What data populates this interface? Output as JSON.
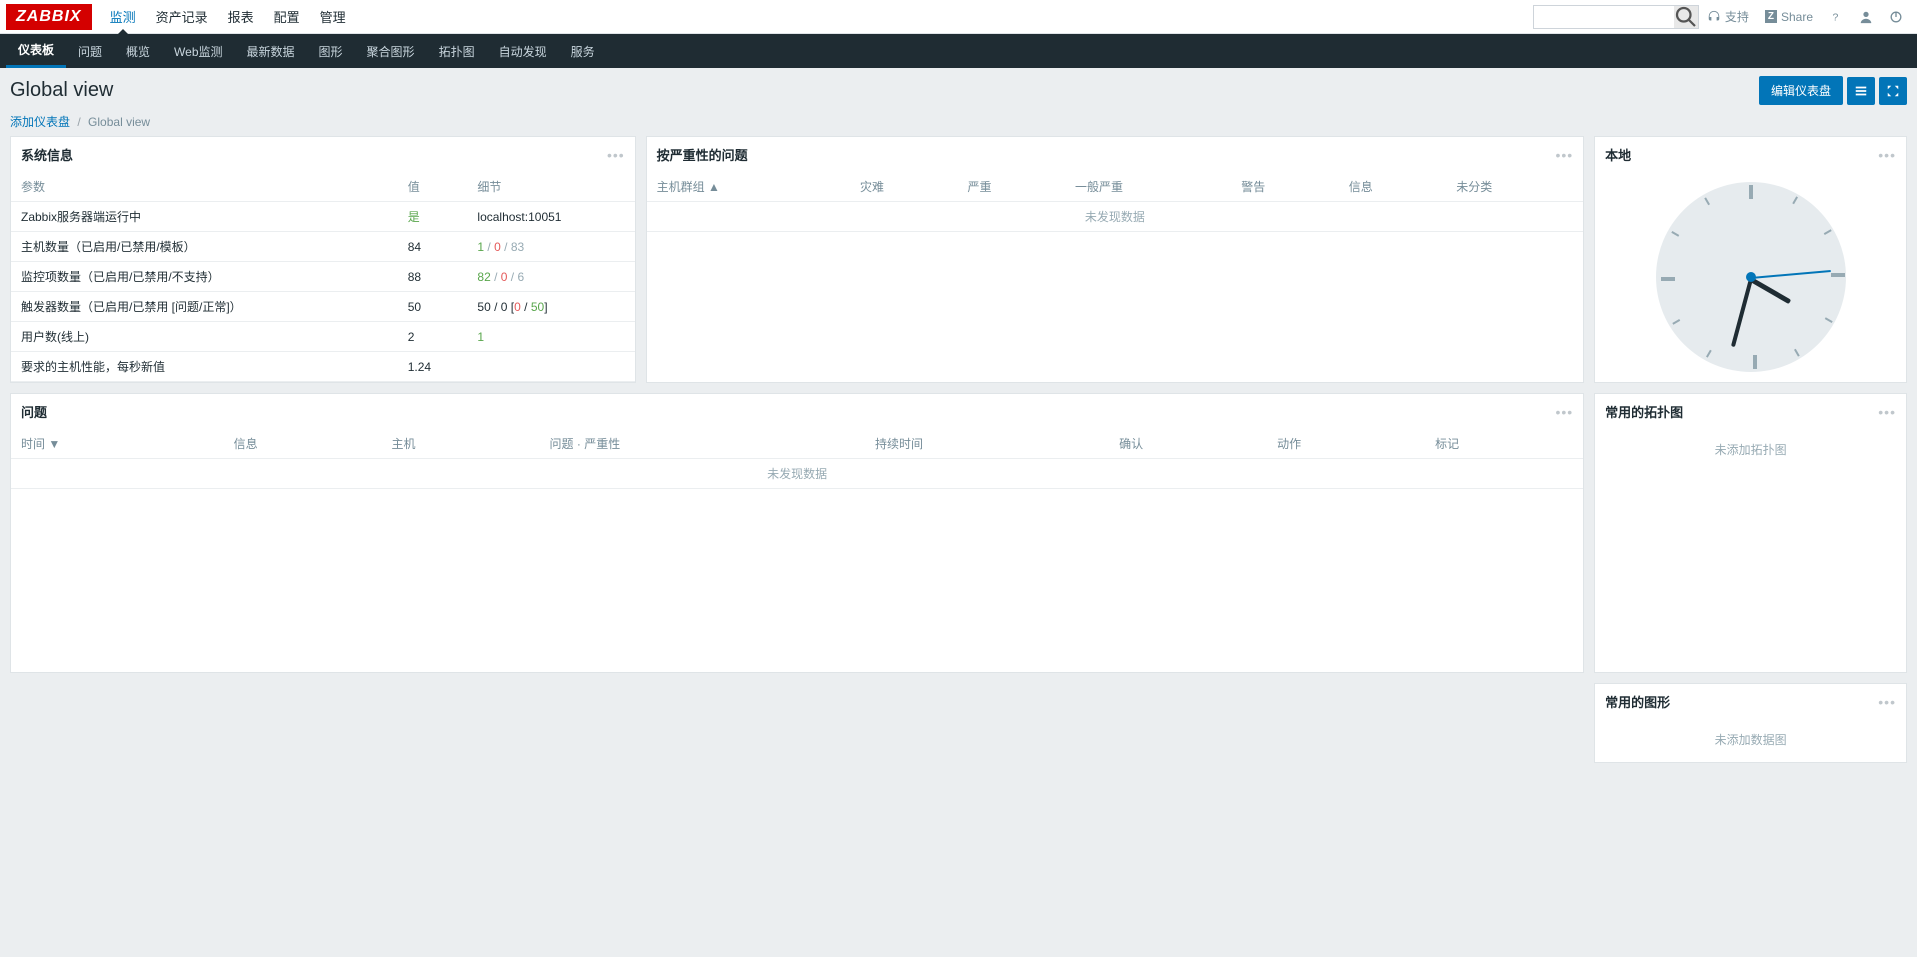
{
  "branding": {
    "logo": "ZABBIX"
  },
  "topnav": {
    "items": [
      {
        "label": "监测",
        "active": true
      },
      {
        "label": "资产记录"
      },
      {
        "label": "报表"
      },
      {
        "label": "配置"
      },
      {
        "label": "管理"
      }
    ],
    "support": "支持",
    "share": "Share"
  },
  "subnav": {
    "items": [
      {
        "label": "仪表板",
        "active": true
      },
      {
        "label": "问题"
      },
      {
        "label": "概览"
      },
      {
        "label": "Web监测"
      },
      {
        "label": "最新数据"
      },
      {
        "label": "图形"
      },
      {
        "label": "聚合图形"
      },
      {
        "label": "拓扑图"
      },
      {
        "label": "自动发现"
      },
      {
        "label": "服务"
      }
    ]
  },
  "page": {
    "title": "Global view",
    "edit_btn": "编辑仪表盘"
  },
  "breadcrumb": {
    "add": "添加仪表盘",
    "current": "Global view"
  },
  "widgets": {
    "sysinfo": {
      "title": "系统信息",
      "headers": {
        "param": "参数",
        "value": "值",
        "detail": "细节"
      },
      "rows": [
        {
          "param": "Zabbix服务器端运行中",
          "value": "是",
          "value_class": "green",
          "detail": "localhost:10051"
        },
        {
          "param": "主机数量（已启用/已禁用/模板）",
          "value": "84",
          "detail_parts": [
            {
              "t": "1",
              "c": "green"
            },
            {
              "t": " / ",
              "c": "grey"
            },
            {
              "t": "0",
              "c": "red"
            },
            {
              "t": " / ",
              "c": "grey"
            },
            {
              "t": "83",
              "c": "grey"
            }
          ]
        },
        {
          "param": "监控项数量（已启用/已禁用/不支持）",
          "value": "88",
          "detail_parts": [
            {
              "t": "82",
              "c": "green"
            },
            {
              "t": " / ",
              "c": "grey"
            },
            {
              "t": "0",
              "c": "red"
            },
            {
              "t": " / ",
              "c": "grey"
            },
            {
              "t": "6",
              "c": "grey"
            }
          ]
        },
        {
          "param": "触发器数量（已启用/已禁用 [问题/正常]）",
          "value": "50",
          "detail_parts": [
            {
              "t": "50",
              "c": ""
            },
            {
              "t": " / ",
              "c": ""
            },
            {
              "t": "0",
              "c": ""
            },
            {
              "t": " [",
              "c": ""
            },
            {
              "t": "0",
              "c": "red"
            },
            {
              "t": " / ",
              "c": ""
            },
            {
              "t": "50",
              "c": "green"
            },
            {
              "t": "]",
              "c": ""
            }
          ]
        },
        {
          "param": "用户数(线上)",
          "value": "2",
          "detail_parts": [
            {
              "t": "1",
              "c": "green"
            }
          ]
        },
        {
          "param": "要求的主机性能，每秒新值",
          "value": "1.24",
          "detail": ""
        }
      ]
    },
    "severity": {
      "title": "按严重性的问题",
      "headers": [
        "主机群组 ▲",
        "灾难",
        "严重",
        "一般严重",
        "警告",
        "信息",
        "未分类"
      ],
      "no_data": "未发现数据"
    },
    "clock": {
      "title": "本地"
    },
    "problems": {
      "title": "问题",
      "headers": [
        "时间 ▼",
        "信息",
        "主机",
        "问题 · 严重性",
        "持续时间",
        "确认",
        "动作",
        "标记"
      ],
      "no_data": "未发现数据"
    },
    "maps": {
      "title": "常用的拓扑图",
      "empty": "未添加拓扑图"
    },
    "graphs": {
      "title": "常用的图形",
      "empty": "未添加数据图"
    }
  }
}
